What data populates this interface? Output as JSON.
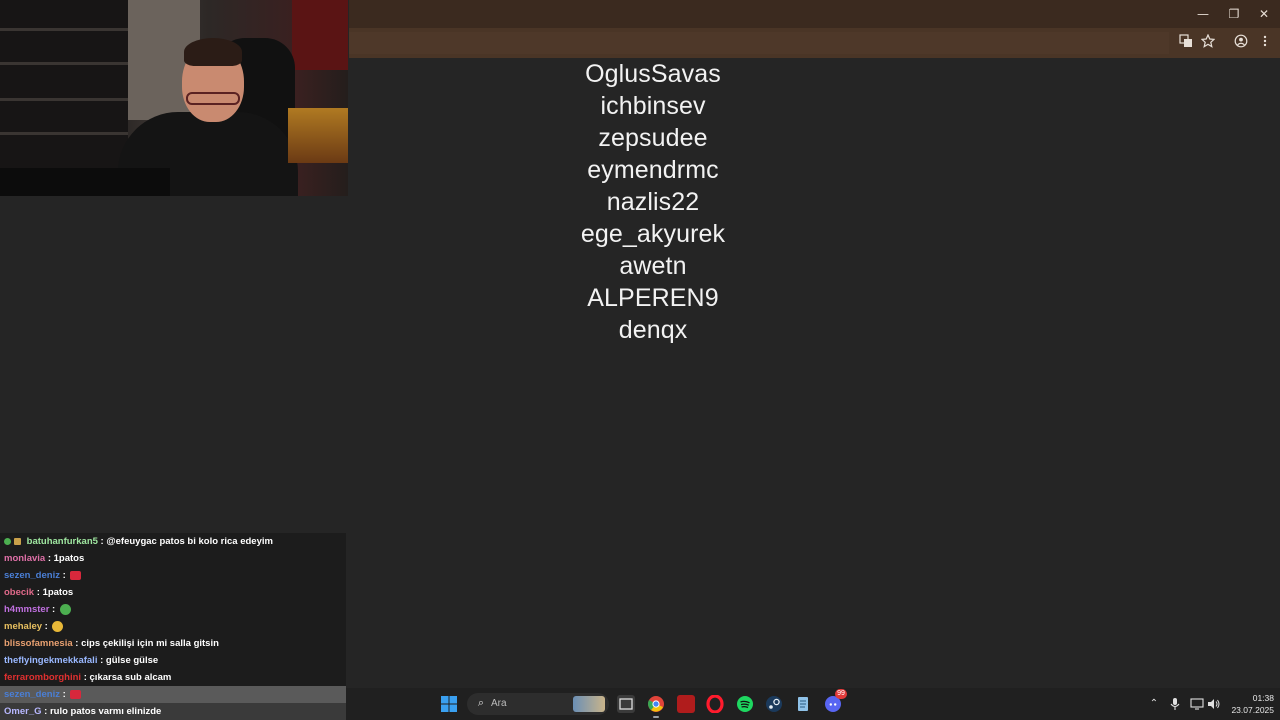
{
  "browser": {
    "window_controls": {
      "minimize_icon": "—",
      "restore_icon": "❐",
      "close_icon": "✕"
    },
    "toolbar_icons": [
      "translate-icon",
      "bookmark-star-icon",
      "profile-icon",
      "menu-dots-icon"
    ]
  },
  "content": {
    "names": [
      "OglusSavas",
      "ichbinsev",
      "zepsudee",
      "eymendrmc",
      "nazlis22",
      "ege_akyurek",
      "awetn",
      "ALPEREN9",
      "denqx"
    ]
  },
  "chat": {
    "messages": [
      {
        "user": "batuhanfurkan5",
        "user_color": "#9fe6a0",
        "text": "@efeuygac patos bi kolo rica edeyim"
      },
      {
        "user": "monlavia",
        "user_color": "#e070a8",
        "text": "1patos"
      },
      {
        "user": "sezen_deniz",
        "user_color": "#4a7fd6",
        "text": ""
      },
      {
        "user": "obecik",
        "user_color": "#e06a8a",
        "text": "1patos"
      },
      {
        "user": "h4mmster",
        "user_color": "#c070e0",
        "text": ""
      },
      {
        "user": "mehaley",
        "user_color": "#e8c060",
        "text": ""
      },
      {
        "user": "blissofamnesia",
        "user_color": "#e8a070",
        "text": "cips çekilişi için mi salla gitsin"
      },
      {
        "user": "theflyingekmekkafali",
        "user_color": "#9ab8ff",
        "text": "gülse gülse"
      },
      {
        "user": "ferraromborghini",
        "user_color": "#e03030",
        "text": "çıkarsa sub alcam"
      },
      {
        "user": "sezen_deniz",
        "user_color": "#4a7fd6",
        "text": ""
      },
      {
        "user": "Omer_G",
        "user_color": "#b8b8ff",
        "text": "rulo patos varmı elinizde"
      }
    ]
  },
  "taskbar": {
    "search_label": "Ara",
    "search_icon": "⌕",
    "discord_badge": "99",
    "clock_time": "01:38",
    "clock_date": "23.07.2025",
    "tray_icons": {
      "chevron": "⌃",
      "mic": "🎤",
      "network": "▭",
      "volume": "🔊"
    }
  },
  "colors": {
    "titlebar": "#3b2a1f",
    "toolbar": "#4a3526",
    "page_background": "#252525",
    "chat_background": "#1c1c1c",
    "taskbar": "#202020"
  }
}
